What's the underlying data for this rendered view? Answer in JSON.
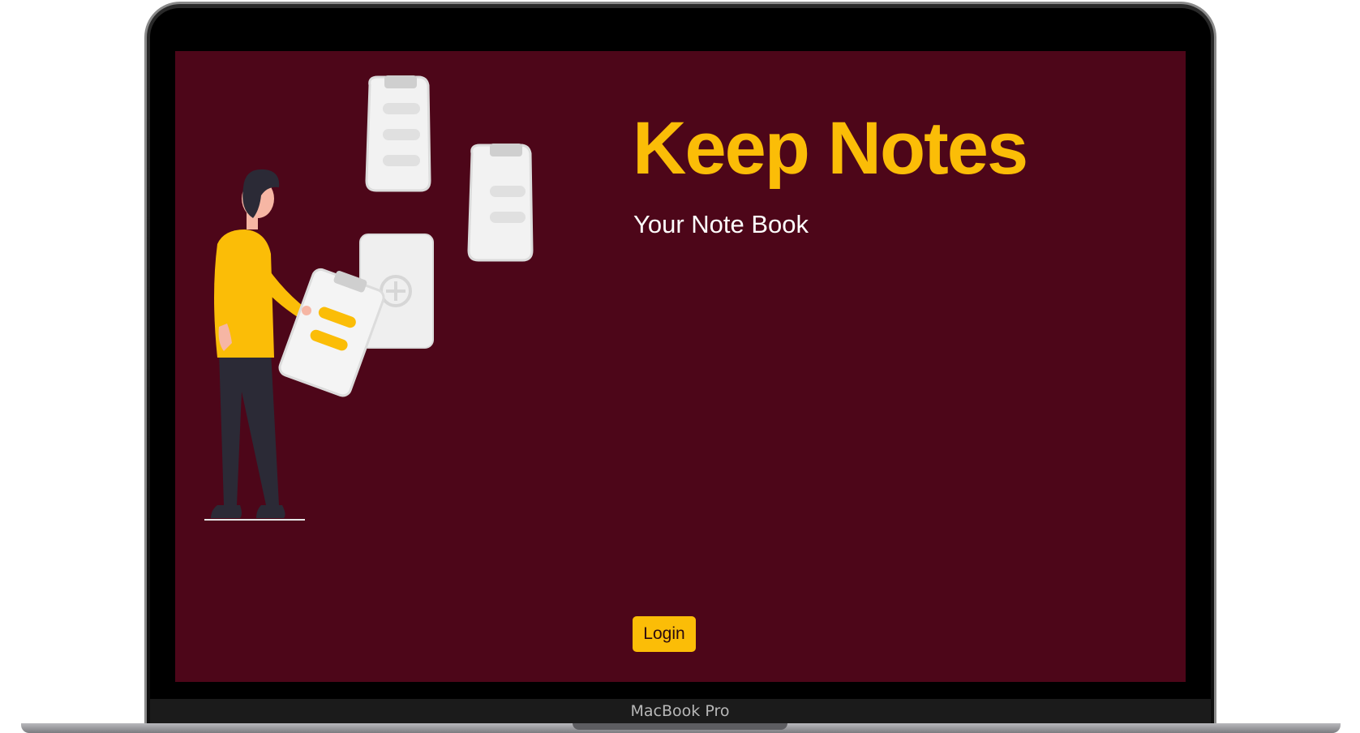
{
  "app": {
    "title": "Keep Notes",
    "subtitle": "Your Note Book",
    "login_label": "Login"
  },
  "device": {
    "brand": "MacBook Pro"
  },
  "colors": {
    "background": "#4d0619",
    "accent": "#fbbd07",
    "text": "#ffffff"
  },
  "illustration": {
    "icons": [
      "person-icon",
      "clipboard-icon",
      "add-note-icon"
    ]
  }
}
